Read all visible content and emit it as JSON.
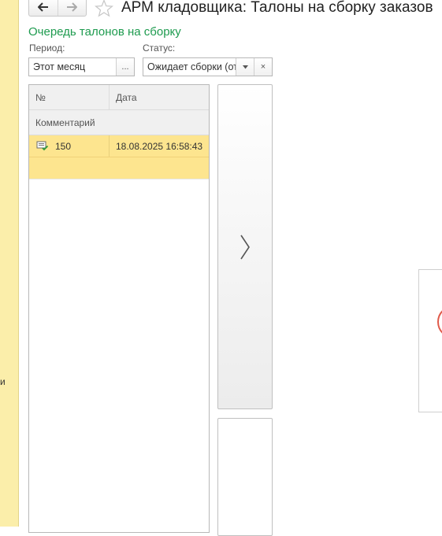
{
  "window": {
    "title": "АРМ кладовщика: Талоны на сборку заказов"
  },
  "toolbar": {
    "back_icon": "arrow-left-icon",
    "forward_icon": "arrow-right-icon",
    "favorite_icon": "star-icon"
  },
  "left_panel": {
    "cut_text": "и"
  },
  "section": {
    "title": "Очередь талонов на сборку"
  },
  "filters": {
    "period": {
      "label": "Период:",
      "value": "Этот месяц",
      "button": "..."
    },
    "status": {
      "label": "Статус:",
      "value": "Ожидает сборки (от",
      "dropdown_icon": "chevron-down-icon",
      "clear_icon": "×"
    }
  },
  "table": {
    "columns": [
      "№",
      "Дата"
    ],
    "subheader": "Комментарий",
    "rows": [
      {
        "icon": "document-check-icon",
        "number": "150",
        "date": "18.08.2025 16:58:43"
      }
    ]
  },
  "side_panel": {
    "expand_icon": "chevron-right-icon"
  },
  "colors": {
    "accent_green": "#1e9b4f",
    "selected_row": "#fde58f",
    "left_panel": "#fbeeaa"
  }
}
